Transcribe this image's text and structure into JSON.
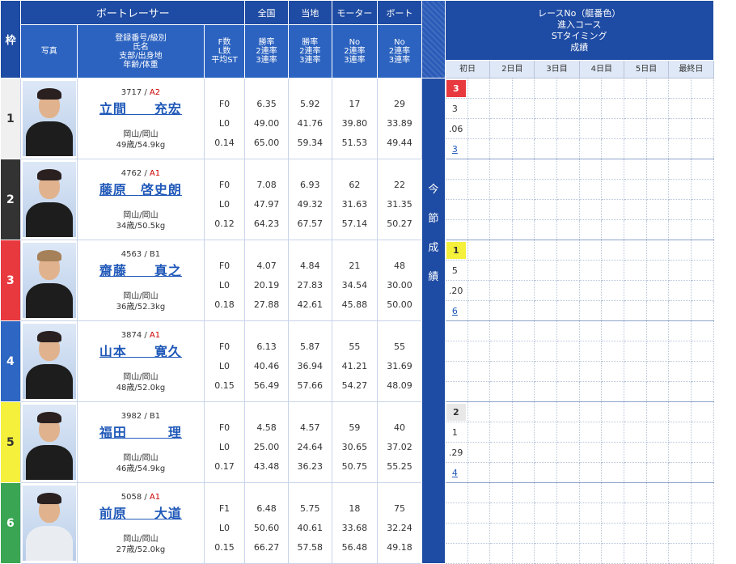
{
  "header": {
    "waku": "枠",
    "boatracer": "ボートレーサー",
    "photo": "写真",
    "info": [
      "登録番号/級別",
      "氏名",
      "支部/出身地",
      "年齢/体重"
    ],
    "fl": [
      "F数",
      "L数",
      "平均ST"
    ],
    "zenkoku": "全国",
    "zenkoku_sub": [
      "勝率",
      "2連率",
      "3連率"
    ],
    "touchi": "当地",
    "touchi_sub": [
      "勝率",
      "2連率",
      "3連率"
    ],
    "motor": "モーター",
    "motor_sub": [
      "No",
      "2連率",
      "3連率"
    ],
    "boat": "ボート",
    "boat_sub": [
      "No",
      "2連率",
      "3連率"
    ],
    "results_title": [
      "レースNo（艇番色）",
      "進入コース",
      "STタイミング",
      "成績"
    ],
    "days": [
      "初日",
      "2日目",
      "3日目",
      "4日目",
      "5日目",
      "最終日"
    ],
    "konsetsu": [
      "今",
      "節",
      "成",
      "績"
    ]
  },
  "colors": {
    "waku": [
      "#f0f0f0",
      "#333333",
      "#e8393f",
      "#2d66c3",
      "#f5f03c",
      "#3aa653"
    ],
    "header_blue": "#1e4ba3"
  },
  "racers": [
    {
      "waku": "1",
      "reg": "3717",
      "cls": "A2",
      "name": "立間　　充宏",
      "branch": "岡山/岡山",
      "age_weight": "49歳/54.9kg",
      "f": "F0",
      "l": "L0",
      "st": "0.14",
      "zen": [
        "6.35",
        "49.00",
        "65.00"
      ],
      "tou": [
        "5.92",
        "41.76",
        "59.34"
      ],
      "mot": [
        "17",
        "39.80",
        "51.53"
      ],
      "boa": [
        "29",
        "33.89",
        "49.44"
      ],
      "res": {
        "race": "3",
        "course": "3",
        "st": ".06",
        "rank": "3"
      }
    },
    {
      "waku": "2",
      "reg": "4762",
      "cls": "A1",
      "name": "藤原　啓史朗",
      "branch": "岡山/岡山",
      "age_weight": "34歳/50.5kg",
      "f": "F0",
      "l": "L0",
      "st": "0.12",
      "zen": [
        "7.08",
        "47.97",
        "64.23"
      ],
      "tou": [
        "6.93",
        "49.32",
        "67.57"
      ],
      "mot": [
        "62",
        "31.63",
        "57.14"
      ],
      "boa": [
        "22",
        "31.35",
        "50.27"
      ],
      "res": null
    },
    {
      "waku": "3",
      "reg": "4563",
      "cls": "B1",
      "name": "齋藤　　真之",
      "branch": "岡山/岡山",
      "age_weight": "36歳/52.3kg",
      "f": "F0",
      "l": "L0",
      "st": "0.18",
      "zen": [
        "4.07",
        "20.19",
        "27.88"
      ],
      "tou": [
        "4.84",
        "27.83",
        "42.61"
      ],
      "mot": [
        "21",
        "34.54",
        "45.88"
      ],
      "boa": [
        "48",
        "30.00",
        "50.00"
      ],
      "res": {
        "race": "1",
        "course": "5",
        "st": ".20",
        "rank": "6"
      }
    },
    {
      "waku": "4",
      "reg": "3874",
      "cls": "A1",
      "name": "山本　　寛久",
      "branch": "岡山/岡山",
      "age_weight": "48歳/52.0kg",
      "f": "F0",
      "l": "L0",
      "st": "0.15",
      "zen": [
        "6.13",
        "40.46",
        "56.49"
      ],
      "tou": [
        "5.87",
        "36.94",
        "57.66"
      ],
      "mot": [
        "55",
        "41.21",
        "54.27"
      ],
      "boa": [
        "55",
        "31.69",
        "48.09"
      ],
      "res": null
    },
    {
      "waku": "5",
      "reg": "3982",
      "cls": "B1",
      "name": "福田　　　理",
      "branch": "岡山/岡山",
      "age_weight": "46歳/54.9kg",
      "f": "F0",
      "l": "L0",
      "st": "0.17",
      "zen": [
        "4.58",
        "25.00",
        "43.48"
      ],
      "tou": [
        "4.57",
        "24.64",
        "36.23"
      ],
      "mot": [
        "59",
        "30.65",
        "50.75"
      ],
      "boa": [
        "40",
        "37.02",
        "55.25"
      ],
      "res": {
        "race": "2",
        "course": "1",
        "st": ".29",
        "rank": "4"
      }
    },
    {
      "waku": "6",
      "reg": "5058",
      "cls": "A1",
      "name": "前原　　大道",
      "branch": "岡山/岡山",
      "age_weight": "27歳/52.0kg",
      "f": "F1",
      "l": "L0",
      "st": "0.15",
      "zen": [
        "6.48",
        "50.60",
        "66.27"
      ],
      "tou": [
        "5.75",
        "40.61",
        "57.58"
      ],
      "mot": [
        "18",
        "33.68",
        "56.48"
      ],
      "boa": [
        "75",
        "32.24",
        "49.18"
      ],
      "res": null
    }
  ]
}
